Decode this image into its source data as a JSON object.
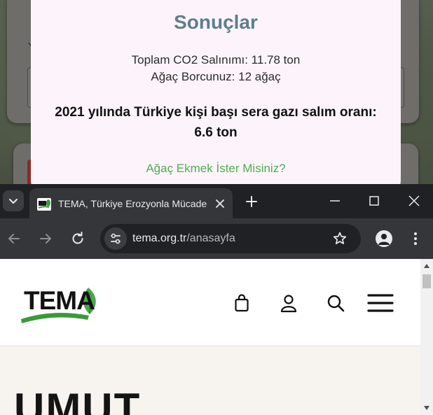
{
  "results": {
    "title": "Sonuçlar",
    "co2_line": "Toplam CO2 Salınımı: 11.78 ton",
    "tree_debt_line": "Ağaç Borcunuz: 12 ağaç",
    "emission_stat": "2021 yılında Türkiye kişi başı sera gazı salım oranı: 6.6 ton",
    "plant_tree_link": "Ağaç Ekmek İster Misiniz?"
  },
  "browser": {
    "tab_title": "TEMA, Türkiye Erozyonla Mücadele",
    "url_host": "tema.org.tr",
    "url_path": "/anasayfa",
    "colors": {
      "frame": "#202124",
      "toolbar": "#35363a",
      "omnibox": "#202124"
    }
  },
  "site": {
    "logo_text": "TEMA",
    "hero_title": "UMUT",
    "header_icons": [
      "shopping-bag-icon",
      "user-icon",
      "search-icon",
      "hamburger-menu-icon"
    ],
    "colors": {
      "logo_green": "#3a9a3a",
      "hero_bg": "#f7f3ef"
    }
  },
  "background_page": {
    "accent_colors": {
      "modal_title": "#5d7f8b",
      "link_green": "#4fae4f"
    }
  }
}
